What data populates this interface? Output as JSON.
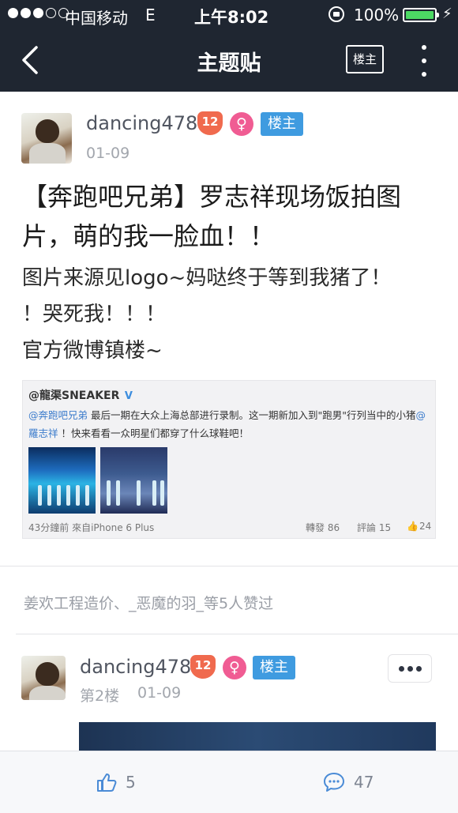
{
  "status_bar": {
    "carrier": "中国移动",
    "network": "E",
    "time": "上午8:02",
    "battery": "100%",
    "battery_level": 1.0,
    "charging_icon": "⚡"
  },
  "nav": {
    "back_icon": "chevron-left",
    "title": "主题贴",
    "owner_only": "楼主",
    "more_icon": "vertical-ellipsis"
  },
  "post": {
    "username": "dancing478",
    "level": "12",
    "gender_icon": "♀",
    "role": "楼主",
    "date": "01-09",
    "title_line1": "【奔跑吧兄弟】罗志祥现场饭拍图",
    "title_line2": "片，萌的我一脸血！！",
    "body_line1": "图片来源见logo~妈哒终于等到我猪了！",
    "body_line2": "！哭死我！！！",
    "body_line3": "官方微博镇楼~",
    "embed": {
      "user": "@龍渠SNEAKER",
      "verified_icon": "V",
      "line1_link": "@奔跑吧兄弟",
      "line1_text": " 最后一期在大众上海总部进行录制。这一期新加入到\"跑男\"行列当中的小猪",
      "line1_link2": "@",
      "line2_link": "羅志祥",
      "line2_text": " ！快来看看一众明星们都穿了什么球鞋吧！",
      "meta": "43分鐘前 來自iPhone 6 Plus",
      "reposts": "轉發 86",
      "comments": "評論 15",
      "like_icon": "👍",
      "likes": "24"
    }
  },
  "likes_line": "姜欢工程造价、_恶魔的羽_等5人赞过",
  "reply": {
    "username": "dancing478",
    "level": "12",
    "gender_icon": "♀",
    "role": "楼主",
    "floor": "第2楼",
    "date": "01-09",
    "more_icon": "horizontal-ellipsis"
  },
  "bottom_bar": {
    "like_icon": "thumb-up",
    "like_count": "5",
    "comment_icon": "speech-bubble",
    "comment_count": "47"
  },
  "colors": {
    "nav_bg": "#1f2631",
    "accent_blue": "#3f9be0",
    "level_badge": "#f06a4e",
    "female_badge": "#f05c93",
    "battery_green": "#4cd964"
  }
}
